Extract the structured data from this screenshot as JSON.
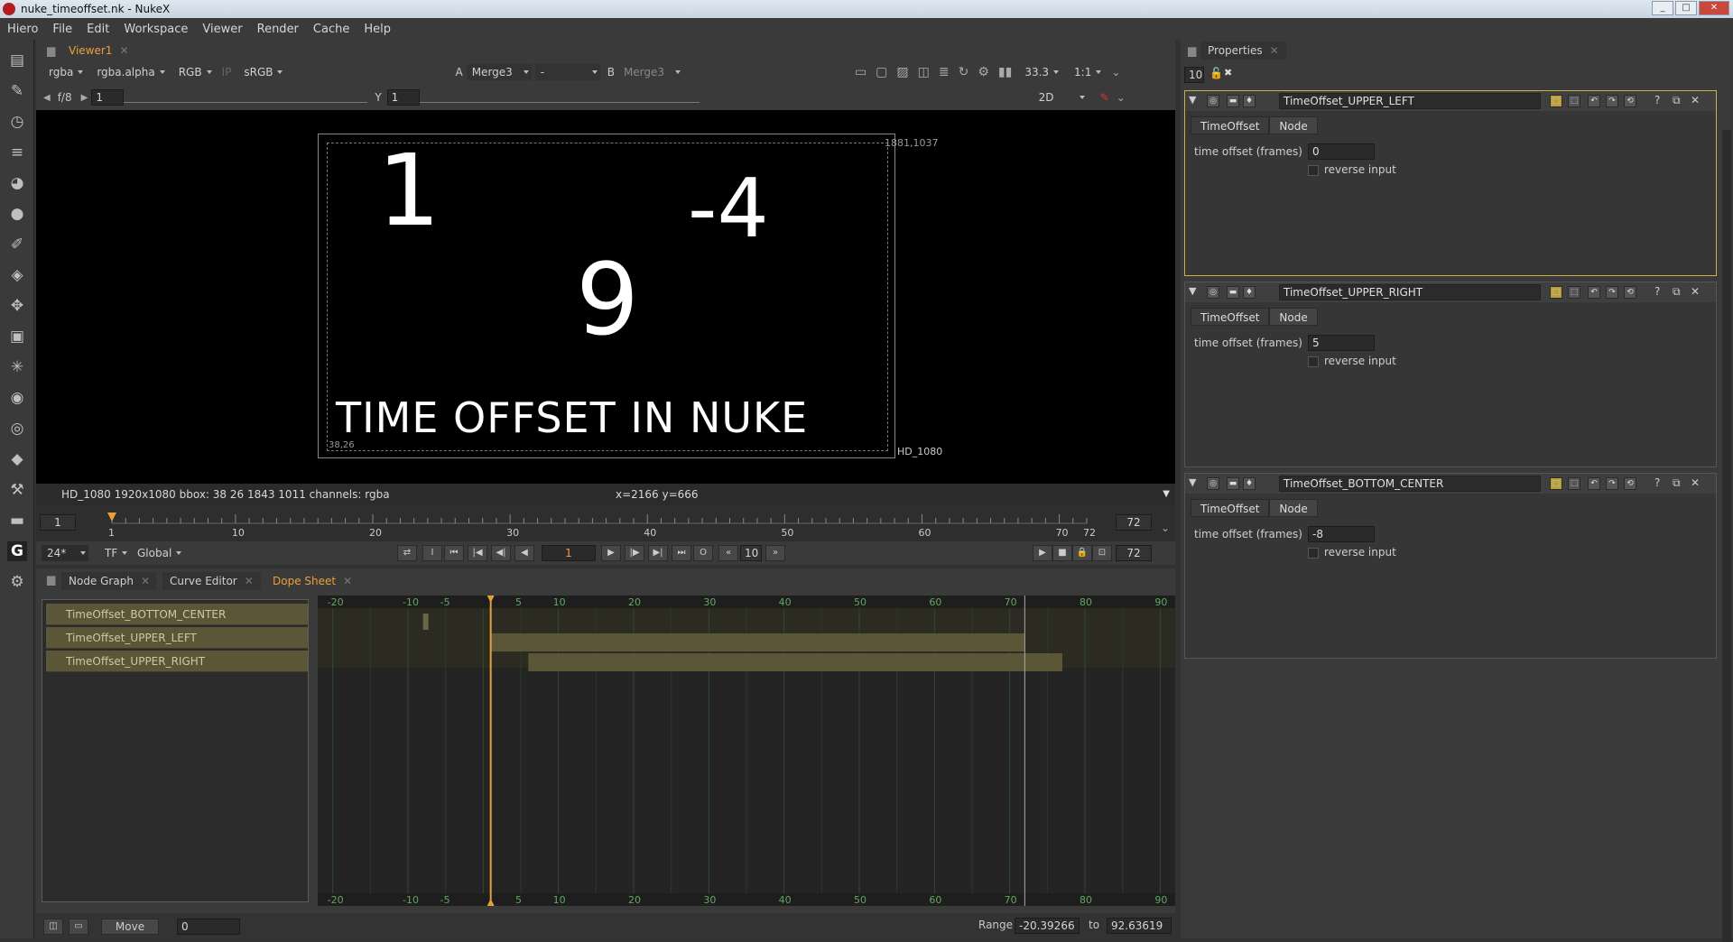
{
  "window": {
    "title": "nuke_timeoffset.nk - NukeX"
  },
  "menu": [
    "Hiero",
    "File",
    "Edit",
    "Workspace",
    "Viewer",
    "Render",
    "Cache",
    "Help"
  ],
  "viewer": {
    "tab": "Viewer1",
    "channels": "rgba",
    "alpha": "rgba.alpha",
    "display": "RGB",
    "ip": "IP",
    "lut": "sRGB",
    "a_label": "A",
    "a_input": "Merge3",
    "mid": "-",
    "b_label": "B",
    "b_input": "Merge3",
    "zoom": "33.3",
    "ratio": "1:1",
    "gain_label": "f/8",
    "gain_value": "1",
    "gamma_label": "Y",
    "gamma_value": "1",
    "mode": "2D",
    "frame_top_right": "1881,1037",
    "frame_bottom_left": "38,26",
    "format_label": "HD_1080",
    "handwriting": {
      "one": "1",
      "minus4": "-4",
      "nine": "9",
      "caption": "TIME OFFSET IN NUKE"
    },
    "info": "HD_1080 1920x1080  bbox: 38 26 1843 1011 channels: rgba",
    "coords": "x=2166 y=666"
  },
  "timeline": {
    "start": "1",
    "end": "72",
    "ticks": [
      "1",
      "10",
      "20",
      "30",
      "40",
      "50",
      "60",
      "70",
      "72"
    ],
    "fps": "24*",
    "tf": "TF",
    "global": "Global",
    "current_frame": "1",
    "step": "10",
    "end_field": "72"
  },
  "bottom_tabs": [
    "Node Graph",
    "Curve Editor",
    "Dope Sheet"
  ],
  "dope": {
    "rows": [
      "TimeOffset_BOTTOM_CENTER",
      "TimeOffset_UPPER_LEFT",
      "TimeOffset_UPPER_RIGHT"
    ],
    "ruler": [
      "-20",
      "-10",
      "-5",
      "5",
      "10",
      "20",
      "30",
      "40",
      "50",
      "60",
      "70",
      "80",
      "90"
    ],
    "move_label": "Move",
    "move_value": "0",
    "range_label": "Range",
    "range_from": "-20.39266",
    "range_to_label": "to",
    "range_to": "92.63619"
  },
  "properties": {
    "tab": "Properties",
    "max_panels": "10",
    "panels": [
      {
        "name": "TimeOffset_UPPER_LEFT",
        "tab1": "TimeOffset",
        "tab2": "Node",
        "label": "time offset (frames)",
        "value": "0",
        "reverse": "reverse input"
      },
      {
        "name": "TimeOffset_UPPER_RIGHT",
        "tab1": "TimeOffset",
        "tab2": "Node",
        "label": "time offset (frames)",
        "value": "5",
        "reverse": "reverse input"
      },
      {
        "name": "TimeOffset_BOTTOM_CENTER",
        "tab1": "TimeOffset",
        "tab2": "Node",
        "label": "time offset (frames)",
        "value": "-8",
        "reverse": "reverse input"
      }
    ]
  },
  "colors": {
    "accent": "#e8a03a",
    "selected_panel": "#c8b24a",
    "dope_bar": "#5b5637"
  }
}
